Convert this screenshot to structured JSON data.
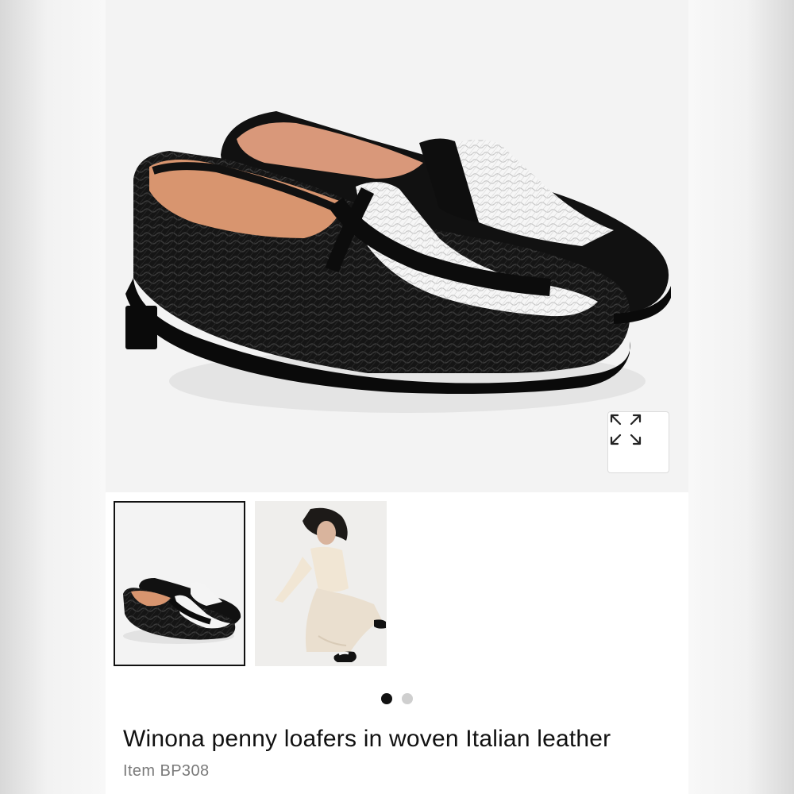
{
  "product": {
    "title": "Winona penny loafers in woven Italian leather",
    "item_code": "Item BP308"
  },
  "gallery": {
    "expand_icon": "expand-arrows-icon",
    "thumbnails": [
      {
        "subject": "loafers pair",
        "selected": true
      },
      {
        "subject": "model wearing loafers",
        "selected": false
      }
    ],
    "page_count": 2,
    "active_page": 1
  },
  "colors": {
    "text": "#111111",
    "muted": "#7a7a7a",
    "dot_active": "#111111",
    "dot_inactive": "#cfcfcf"
  }
}
